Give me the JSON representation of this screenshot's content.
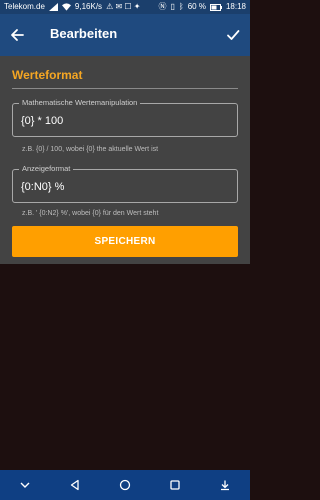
{
  "status_bar": {
    "carrier": "Telekom.de",
    "network_speed": "9,16K/s",
    "battery_percent": "60 %",
    "time": "18:18",
    "icons": [
      "signal-icon",
      "wifi-icon",
      "notification-icons",
      "nfc-icon",
      "vibrate-icon",
      "bluetooth-icon",
      "battery-icon"
    ]
  },
  "app_bar": {
    "title": "Bearbeiten",
    "back_icon": "arrow-left-icon",
    "confirm_icon": "check-icon"
  },
  "form": {
    "section_title": "Werteformat",
    "fields": [
      {
        "label": "Mathematische Wertemanipulation",
        "value": "{0} * 100",
        "helper": "z.B. {0} / 100, wobei {0} the aktuelle Wert ist"
      },
      {
        "label": "Anzeigeformat",
        "value": "{0:N0} %",
        "helper": "z.B. ' {0:N2} %', wobei {0} für den Wert steht"
      }
    ],
    "save_label": "SPEICHERN"
  },
  "nav_bar": {
    "icons": [
      "dropdown-icon",
      "back-triangle-icon",
      "home-circle-icon",
      "recents-square-icon",
      "download-icon"
    ]
  },
  "colors": {
    "status_bar": "#1b3f6c",
    "app_bar": "#1f4a7f",
    "accent": "#f5a623",
    "button": "#ff9f00",
    "panel": "#434343",
    "background": "#1d0f0f",
    "nav_bar": "#0f3f83"
  }
}
